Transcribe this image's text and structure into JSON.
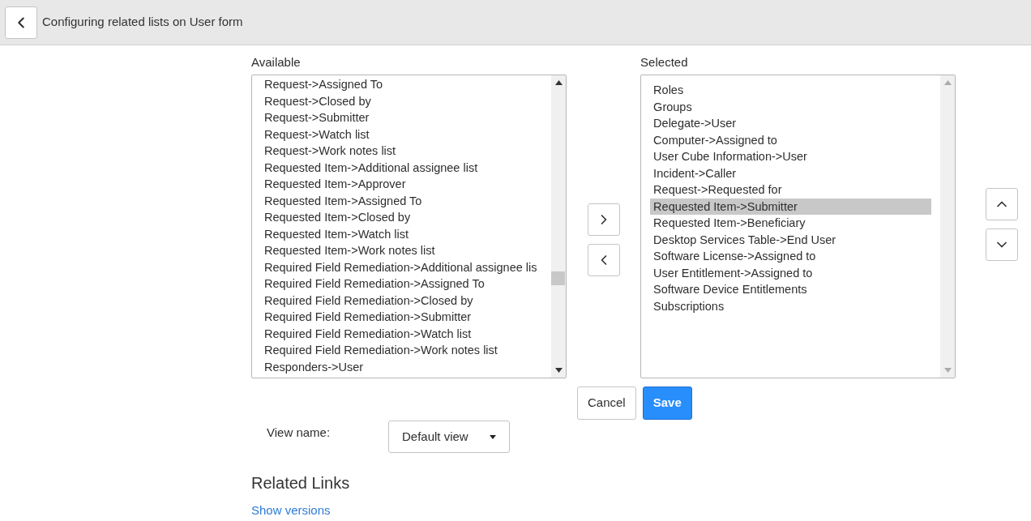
{
  "header": {
    "title": "Configuring related lists on User form"
  },
  "available": {
    "label": "Available",
    "items": [
      {
        "text": "Request->Assigned To",
        "selected": false
      },
      {
        "text": "Request->Closed by",
        "selected": false
      },
      {
        "text": "Request->Submitter",
        "selected": false
      },
      {
        "text": "Request->Watch list",
        "selected": false
      },
      {
        "text": "Request->Work notes list",
        "selected": false
      },
      {
        "text": "Requested Item->Additional assignee list",
        "selected": false
      },
      {
        "text": "Requested Item->Approver",
        "selected": false
      },
      {
        "text": "Requested Item->Assigned To",
        "selected": false
      },
      {
        "text": "Requested Item->Closed by",
        "selected": false
      },
      {
        "text": "Requested Item->Watch list",
        "selected": false
      },
      {
        "text": "Requested Item->Work notes list",
        "selected": false
      },
      {
        "text": "Required Field Remediation->Additional assignee lis",
        "selected": false
      },
      {
        "text": "Required Field Remediation->Assigned To",
        "selected": false
      },
      {
        "text": "Required Field Remediation->Closed by",
        "selected": false
      },
      {
        "text": "Required Field Remediation->Submitter",
        "selected": false
      },
      {
        "text": "Required Field Remediation->Watch list",
        "selected": false
      },
      {
        "text": "Required Field Remediation->Work notes list",
        "selected": false
      },
      {
        "text": "Responders->User",
        "selected": false
      }
    ]
  },
  "selected": {
    "label": "Selected",
    "items": [
      {
        "text": "Roles",
        "selected": false
      },
      {
        "text": "Groups",
        "selected": false
      },
      {
        "text": "Delegate->User",
        "selected": false
      },
      {
        "text": "Computer->Assigned to",
        "selected": false
      },
      {
        "text": "User Cube Information->User",
        "selected": false
      },
      {
        "text": "Incident->Caller",
        "selected": false
      },
      {
        "text": "Request->Requested for",
        "selected": false
      },
      {
        "text": "Requested Item->Submitter",
        "selected": true
      },
      {
        "text": "Requested Item->Beneficiary",
        "selected": false
      },
      {
        "text": "Desktop Services Table->End User",
        "selected": false
      },
      {
        "text": "Software License->Assigned to",
        "selected": false
      },
      {
        "text": "User Entitlement->Assigned to",
        "selected": false
      },
      {
        "text": "Software Device Entitlements",
        "selected": false
      },
      {
        "text": "Subscriptions",
        "selected": false
      }
    ]
  },
  "buttons": {
    "cancel": "Cancel",
    "save": "Save"
  },
  "view_name": {
    "label": "View name:",
    "value": "Default view"
  },
  "related_links": {
    "title": "Related Links",
    "links": [
      "Show versions"
    ]
  }
}
